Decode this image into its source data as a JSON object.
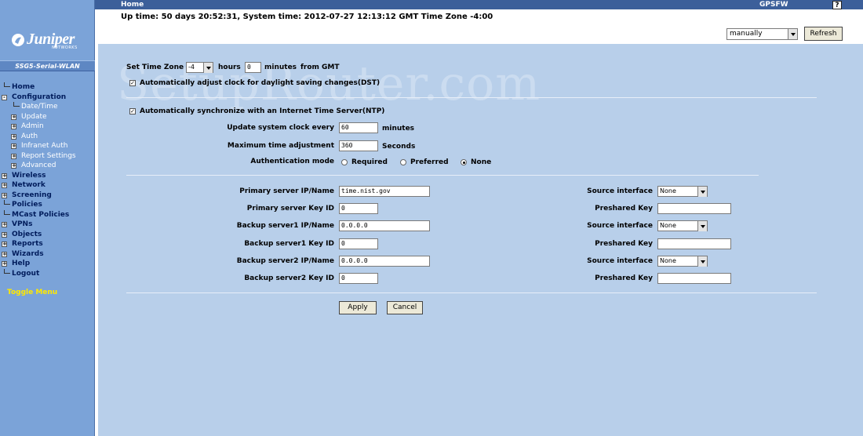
{
  "topbar": {
    "home": "Home",
    "device_name": "GPSFW",
    "help": "?"
  },
  "status_line": "Up time: 50 days 20:52:31, System time: 2012-07-27 12:13:12 GMT Time Zone -4:00",
  "toolbar": {
    "mode_value": "manually",
    "refresh_label": "Refresh"
  },
  "brand": {
    "logo_text": "Juniper",
    "logo_sub": "NETWORKS",
    "device_model": "SSG5-Serial-WLAN"
  },
  "nav": {
    "items": [
      {
        "label": "Home",
        "level": 0,
        "expander": ""
      },
      {
        "label": "Configuration",
        "level": 0,
        "expander": "-"
      },
      {
        "label": "Date/Time",
        "level": 1,
        "expander": ""
      },
      {
        "label": "Update",
        "level": 1,
        "expander": "+"
      },
      {
        "label": "Admin",
        "level": 1,
        "expander": "+"
      },
      {
        "label": "Auth",
        "level": 1,
        "expander": "+"
      },
      {
        "label": "Infranet Auth",
        "level": 1,
        "expander": "+"
      },
      {
        "label": "Report Settings",
        "level": 1,
        "expander": "+"
      },
      {
        "label": "Advanced",
        "level": 1,
        "expander": "+"
      },
      {
        "label": "Wireless",
        "level": 0,
        "expander": "+"
      },
      {
        "label": "Network",
        "level": 0,
        "expander": "+"
      },
      {
        "label": "Screening",
        "level": 0,
        "expander": "+"
      },
      {
        "label": "Policies",
        "level": 0,
        "expander": ""
      },
      {
        "label": "MCast Policies",
        "level": 0,
        "expander": ""
      },
      {
        "label": "VPNs",
        "level": 0,
        "expander": "+"
      },
      {
        "label": "Objects",
        "level": 0,
        "expander": "+"
      },
      {
        "label": "Reports",
        "level": 0,
        "expander": "+"
      },
      {
        "label": "Wizards",
        "level": 0,
        "expander": "+"
      },
      {
        "label": "Help",
        "level": 0,
        "expander": "+"
      },
      {
        "label": "Logout",
        "level": 0,
        "expander": ""
      }
    ],
    "toggle_menu": "Toggle Menu"
  },
  "watermark": "SetupRouter.com",
  "timezone": {
    "set_label": "Set Time Zone",
    "hours_value": "-4",
    "hours_label": "hours",
    "minutes_value": "0",
    "minutes_label": "minutes",
    "from_gmt": "from GMT",
    "dst_checked": "✓",
    "dst_label": "Automatically adjust clock for daylight saving changes(DST)"
  },
  "ntp": {
    "sync_checked": "✓",
    "sync_label": "Automatically synchronize with an Internet Time Server(NTP)",
    "update_label": "Update system clock every",
    "update_value": "60",
    "update_unit": "minutes",
    "max_adj_label": "Maximum time adjustment",
    "max_adj_value": "360",
    "max_adj_unit": "Seconds",
    "auth_label": "Authentication mode",
    "auth_options": [
      "Required",
      "Preferred",
      "None"
    ],
    "auth_selected": "None"
  },
  "servers": {
    "rows": [
      {
        "label": "Primary server IP/Name",
        "value": "time.nist.gov",
        "right_label": "Source interface",
        "right_value": "None",
        "right_type": "select"
      },
      {
        "label": "Primary server Key ID",
        "value": "0",
        "right_label": "Preshared Key",
        "right_value": "",
        "right_type": "text"
      },
      {
        "label": "Backup server1 IP/Name",
        "value": "0.0.0.0",
        "right_label": "Source interface",
        "right_value": "None",
        "right_type": "select"
      },
      {
        "label": "Backup server1 Key ID",
        "value": "0",
        "right_label": "Preshared Key",
        "right_value": "",
        "right_type": "text"
      },
      {
        "label": "Backup server2 IP/Name",
        "value": "0.0.0.0",
        "right_label": "Source interface",
        "right_value": "None",
        "right_type": "select"
      },
      {
        "label": "Backup server2 Key ID",
        "value": "0",
        "right_label": "Preshared Key",
        "right_value": "",
        "right_type": "text"
      }
    ]
  },
  "actions": {
    "apply_label": "Apply",
    "cancel_label": "Cancel"
  }
}
